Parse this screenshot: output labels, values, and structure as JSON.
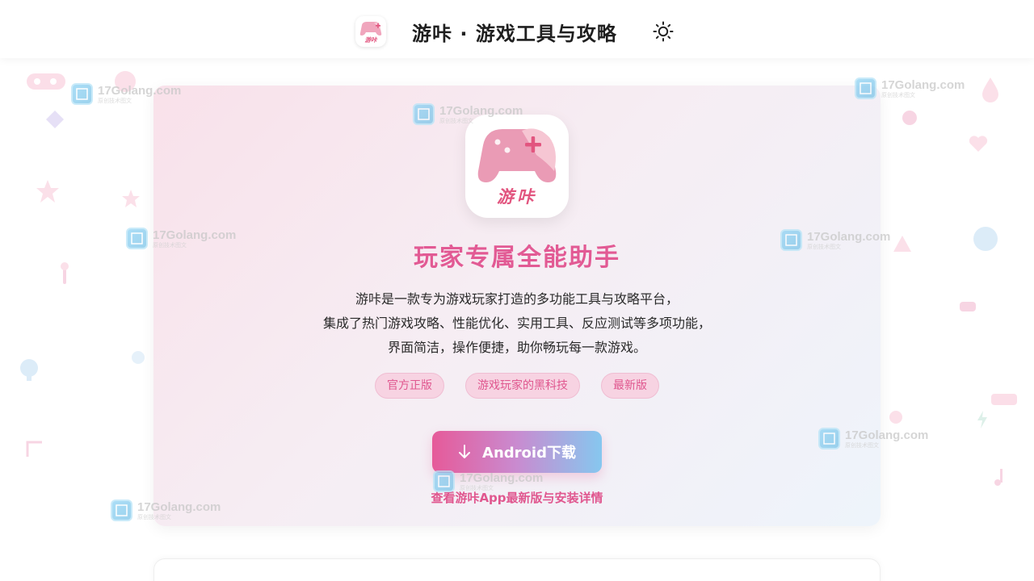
{
  "header": {
    "title": "游咔 · 游戏工具与攻略",
    "logo_text": "游咔"
  },
  "hero": {
    "app_icon_text": "游咔",
    "title": "玩家专属全能助手",
    "desc_lines": [
      "游咔是一款专为游戏玩家打造的多功能工具与攻略平台，",
      "集成了热门游戏攻略、性能优化、实用工具、反应测试等多项功能，",
      "界面简洁，操作便捷，助你畅玩每一款游戏。"
    ],
    "tags": [
      "官方正版",
      "游戏玩家的黑科技",
      "最新版"
    ],
    "download_label": "Android下载",
    "detail_link": "查看游咔App最新版与安装详情"
  },
  "watermark": {
    "text": "17Golang.com",
    "sub": "原创技术图文"
  },
  "colors": {
    "accent": "#e25a94",
    "tag_bg": "#f7d3e2",
    "button_start": "#e65a99",
    "button_end": "#86c7ef"
  },
  "icons": {
    "theme_toggle": "sun-icon",
    "download": "arrow-down-icon",
    "app": "gamepad-icon"
  }
}
